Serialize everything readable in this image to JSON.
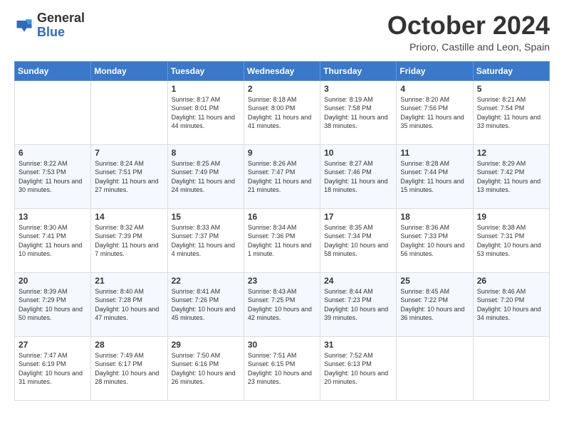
{
  "logo": {
    "general": "General",
    "blue": "Blue"
  },
  "header": {
    "month": "October 2024",
    "location": "Prioro, Castille and Leon, Spain"
  },
  "days_of_week": [
    "Sunday",
    "Monday",
    "Tuesday",
    "Wednesday",
    "Thursday",
    "Friday",
    "Saturday"
  ],
  "weeks": [
    [
      null,
      null,
      {
        "day": "1",
        "sunrise": "Sunrise: 8:17 AM",
        "sunset": "Sunset: 8:01 PM",
        "daylight": "Daylight: 11 hours and 44 minutes."
      },
      {
        "day": "2",
        "sunrise": "Sunrise: 8:18 AM",
        "sunset": "Sunset: 8:00 PM",
        "daylight": "Daylight: 11 hours and 41 minutes."
      },
      {
        "day": "3",
        "sunrise": "Sunrise: 8:19 AM",
        "sunset": "Sunset: 7:58 PM",
        "daylight": "Daylight: 11 hours and 38 minutes."
      },
      {
        "day": "4",
        "sunrise": "Sunrise: 8:20 AM",
        "sunset": "Sunset: 7:56 PM",
        "daylight": "Daylight: 11 hours and 35 minutes."
      },
      {
        "day": "5",
        "sunrise": "Sunrise: 8:21 AM",
        "sunset": "Sunset: 7:54 PM",
        "daylight": "Daylight: 11 hours and 33 minutes."
      }
    ],
    [
      {
        "day": "6",
        "sunrise": "Sunrise: 8:22 AM",
        "sunset": "Sunset: 7:53 PM",
        "daylight": "Daylight: 11 hours and 30 minutes."
      },
      {
        "day": "7",
        "sunrise": "Sunrise: 8:24 AM",
        "sunset": "Sunset: 7:51 PM",
        "daylight": "Daylight: 11 hours and 27 minutes."
      },
      {
        "day": "8",
        "sunrise": "Sunrise: 8:25 AM",
        "sunset": "Sunset: 7:49 PM",
        "daylight": "Daylight: 11 hours and 24 minutes."
      },
      {
        "day": "9",
        "sunrise": "Sunrise: 8:26 AM",
        "sunset": "Sunset: 7:47 PM",
        "daylight": "Daylight: 11 hours and 21 minutes."
      },
      {
        "day": "10",
        "sunrise": "Sunrise: 8:27 AM",
        "sunset": "Sunset: 7:46 PM",
        "daylight": "Daylight: 11 hours and 18 minutes."
      },
      {
        "day": "11",
        "sunrise": "Sunrise: 8:28 AM",
        "sunset": "Sunset: 7:44 PM",
        "daylight": "Daylight: 11 hours and 15 minutes."
      },
      {
        "day": "12",
        "sunrise": "Sunrise: 8:29 AM",
        "sunset": "Sunset: 7:42 PM",
        "daylight": "Daylight: 11 hours and 13 minutes."
      }
    ],
    [
      {
        "day": "13",
        "sunrise": "Sunrise: 8:30 AM",
        "sunset": "Sunset: 7:41 PM",
        "daylight": "Daylight: 11 hours and 10 minutes."
      },
      {
        "day": "14",
        "sunrise": "Sunrise: 8:32 AM",
        "sunset": "Sunset: 7:39 PM",
        "daylight": "Daylight: 11 hours and 7 minutes."
      },
      {
        "day": "15",
        "sunrise": "Sunrise: 8:33 AM",
        "sunset": "Sunset: 7:37 PM",
        "daylight": "Daylight: 11 hours and 4 minutes."
      },
      {
        "day": "16",
        "sunrise": "Sunrise: 8:34 AM",
        "sunset": "Sunset: 7:36 PM",
        "daylight": "Daylight: 11 hours and 1 minute."
      },
      {
        "day": "17",
        "sunrise": "Sunrise: 8:35 AM",
        "sunset": "Sunset: 7:34 PM",
        "daylight": "Daylight: 10 hours and 58 minutes."
      },
      {
        "day": "18",
        "sunrise": "Sunrise: 8:36 AM",
        "sunset": "Sunset: 7:33 PM",
        "daylight": "Daylight: 10 hours and 56 minutes."
      },
      {
        "day": "19",
        "sunrise": "Sunrise: 8:38 AM",
        "sunset": "Sunset: 7:31 PM",
        "daylight": "Daylight: 10 hours and 53 minutes."
      }
    ],
    [
      {
        "day": "20",
        "sunrise": "Sunrise: 8:39 AM",
        "sunset": "Sunset: 7:29 PM",
        "daylight": "Daylight: 10 hours and 50 minutes."
      },
      {
        "day": "21",
        "sunrise": "Sunrise: 8:40 AM",
        "sunset": "Sunset: 7:28 PM",
        "daylight": "Daylight: 10 hours and 47 minutes."
      },
      {
        "day": "22",
        "sunrise": "Sunrise: 8:41 AM",
        "sunset": "Sunset: 7:26 PM",
        "daylight": "Daylight: 10 hours and 45 minutes."
      },
      {
        "day": "23",
        "sunrise": "Sunrise: 8:43 AM",
        "sunset": "Sunset: 7:25 PM",
        "daylight": "Daylight: 10 hours and 42 minutes."
      },
      {
        "day": "24",
        "sunrise": "Sunrise: 8:44 AM",
        "sunset": "Sunset: 7:23 PM",
        "daylight": "Daylight: 10 hours and 39 minutes."
      },
      {
        "day": "25",
        "sunrise": "Sunrise: 8:45 AM",
        "sunset": "Sunset: 7:22 PM",
        "daylight": "Daylight: 10 hours and 36 minutes."
      },
      {
        "day": "26",
        "sunrise": "Sunrise: 8:46 AM",
        "sunset": "Sunset: 7:20 PM",
        "daylight": "Daylight: 10 hours and 34 minutes."
      }
    ],
    [
      {
        "day": "27",
        "sunrise": "Sunrise: 7:47 AM",
        "sunset": "Sunset: 6:19 PM",
        "daylight": "Daylight: 10 hours and 31 minutes."
      },
      {
        "day": "28",
        "sunrise": "Sunrise: 7:49 AM",
        "sunset": "Sunset: 6:17 PM",
        "daylight": "Daylight: 10 hours and 28 minutes."
      },
      {
        "day": "29",
        "sunrise": "Sunrise: 7:50 AM",
        "sunset": "Sunset: 6:16 PM",
        "daylight": "Daylight: 10 hours and 26 minutes."
      },
      {
        "day": "30",
        "sunrise": "Sunrise: 7:51 AM",
        "sunset": "Sunset: 6:15 PM",
        "daylight": "Daylight: 10 hours and 23 minutes."
      },
      {
        "day": "31",
        "sunrise": "Sunrise: 7:52 AM",
        "sunset": "Sunset: 6:13 PM",
        "daylight": "Daylight: 10 hours and 20 minutes."
      },
      null,
      null
    ]
  ]
}
